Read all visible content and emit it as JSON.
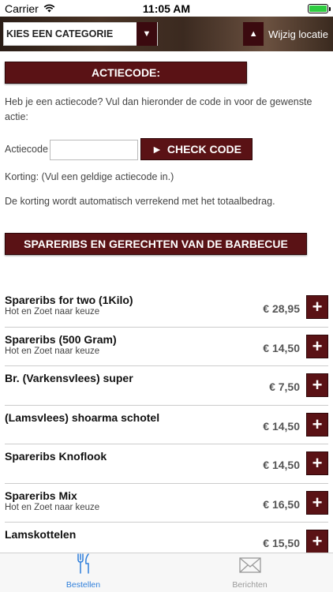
{
  "status": {
    "carrier": "Carrier",
    "time": "11:05 AM",
    "battery_level": 1.0
  },
  "header": {
    "category_select": "KIES EEN CATEGORIE",
    "location_button": "Wijzig locatie"
  },
  "promo": {
    "title": "ACTIECODE:",
    "intro": "Heb je een actiecode? Vul dan hieronder de code in voor de gewenste actie:",
    "code_label": "Actiecode",
    "code_value": "",
    "check_button": "CHECK CODE",
    "discount_text": "Korting: (Vul een geldige actiecode in.)",
    "discount_note": "De korting wordt automatisch verrekend met het totaalbedrag."
  },
  "section": {
    "title": "SPARERIBS EN GERECHTEN VAN DE BARBECUE"
  },
  "menu_items": [
    {
      "name": "Spareribs for two (1Kilo)",
      "sub": "Hot en Zoet naar keuze",
      "price": "€ 28,95"
    },
    {
      "name": "Spareribs (500 Gram)",
      "sub": "Hot en Zoet naar keuze",
      "price": "€ 14,50"
    },
    {
      "name": "Br. (Varkensvlees) super",
      "sub": "",
      "price": "€ 7,50"
    },
    {
      "name": "(Lamsvlees) shoarma schotel",
      "sub": "",
      "price": "€ 14,50"
    },
    {
      "name": "Spareribs Knoflook",
      "sub": "",
      "price": "€ 14,50"
    },
    {
      "name": "Spareribs Mix",
      "sub": "Hot en Zoet naar keuze",
      "price": "€ 16,50"
    },
    {
      "name": "Lamskottelen",
      "sub": "",
      "price": "€ 15,50"
    }
  ],
  "tabs": [
    {
      "label": "Bestellen",
      "icon": "fork-knife-icon",
      "active": true
    },
    {
      "label": "Berichten",
      "icon": "envelope-icon",
      "active": false
    }
  ],
  "colors": {
    "accent": "#5a1215",
    "tab_active": "#2f7fdb"
  }
}
